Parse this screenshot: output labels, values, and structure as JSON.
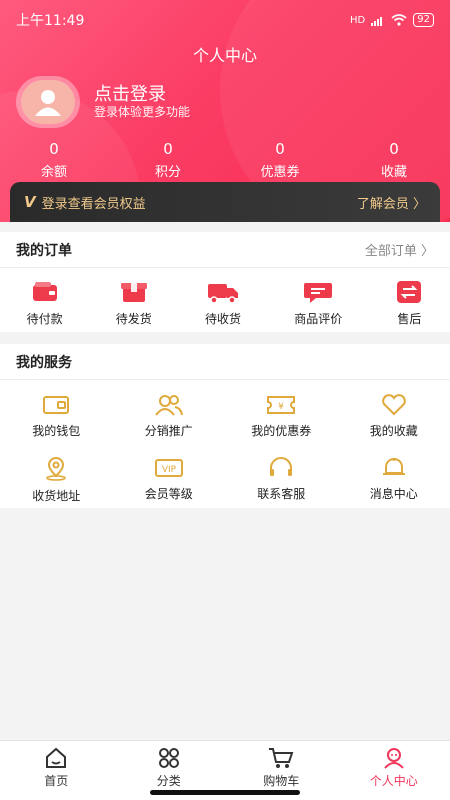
{
  "status": {
    "time": "上午11:49",
    "battery": "92",
    "hd": "HD"
  },
  "page_title": "个人中心",
  "profile": {
    "login_title": "点击登录",
    "login_subtitle": "登录体验更多功能"
  },
  "stats": [
    {
      "value": "0",
      "label": "余额"
    },
    {
      "value": "0",
      "label": "积分"
    },
    {
      "value": "0",
      "label": "优惠券"
    },
    {
      "value": "0",
      "label": "收藏"
    }
  ],
  "member_banner": {
    "mark": "V",
    "text": "登录查看会员权益",
    "link": "了解会员 〉"
  },
  "orders": {
    "title": "我的订单",
    "more": "全部订单 〉",
    "items": [
      {
        "label": "待付款",
        "icon": "wallet-icon"
      },
      {
        "label": "待发货",
        "icon": "package-icon"
      },
      {
        "label": "待收货",
        "icon": "truck-icon"
      },
      {
        "label": "商品评价",
        "icon": "comment-icon"
      },
      {
        "label": "售后",
        "icon": "exchange-icon"
      }
    ]
  },
  "services": {
    "title": "我的服务",
    "items": [
      {
        "label": "我的钱包",
        "icon": "wallet-icon"
      },
      {
        "label": "分销推广",
        "icon": "users-icon"
      },
      {
        "label": "我的优惠券",
        "icon": "coupon-icon"
      },
      {
        "label": "我的收藏",
        "icon": "heart-icon"
      },
      {
        "label": "收货地址",
        "icon": "location-icon"
      },
      {
        "label": "会员等级",
        "icon": "vip-icon"
      },
      {
        "label": "联系客服",
        "icon": "headset-icon"
      },
      {
        "label": "消息中心",
        "icon": "bell-icon"
      }
    ],
    "vip_text": "VIP"
  },
  "tabbar": [
    {
      "label": "首页",
      "icon": "home-icon"
    },
    {
      "label": "分类",
      "icon": "category-icon"
    },
    {
      "label": "购物车",
      "icon": "cart-icon"
    },
    {
      "label": "个人中心",
      "icon": "user-icon",
      "active": true
    }
  ],
  "colors": {
    "accent": "#f0365a",
    "gold": "#e0a93b",
    "red_icon": "#ee3b4b"
  }
}
